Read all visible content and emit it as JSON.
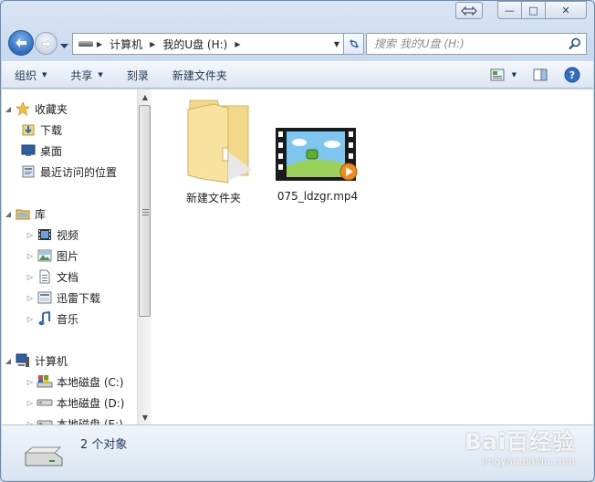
{
  "window": {
    "caption": {
      "minimize": "—",
      "maximize": "□",
      "close": "✕"
    }
  },
  "address": {
    "segments": [
      "计算机",
      "我的U盘 (H:)"
    ]
  },
  "search": {
    "placeholder": "搜索 我的U盘 (H:)"
  },
  "toolbar": {
    "organize": "组织",
    "share": "共享",
    "burn": "刻录",
    "new_folder": "新建文件夹"
  },
  "nav_tree": {
    "favorites": {
      "label": "收藏夹",
      "items": [
        "下载",
        "桌面",
        "最近访问的位置"
      ]
    },
    "libraries": {
      "label": "库",
      "items": [
        "视频",
        "图片",
        "文档",
        "迅雷下载",
        "音乐"
      ]
    },
    "computer": {
      "label": "计算机",
      "items": [
        "本地磁盘 (C:)",
        "本地磁盘 (D:)",
        "本地磁盘 (E:)"
      ]
    }
  },
  "files": [
    {
      "name": "新建文件夹",
      "type": "folder"
    },
    {
      "name": "075_ldzgr.mp4",
      "type": "video"
    }
  ],
  "status": {
    "count": "2 个对象"
  },
  "watermark": {
    "text": "Bai百经验",
    "sub": "jingyan.baidu.com"
  },
  "colors": {
    "accent": "#2d6cc0",
    "window_frame": "#c9d9ee",
    "toolbar_text": "#1e395b"
  }
}
